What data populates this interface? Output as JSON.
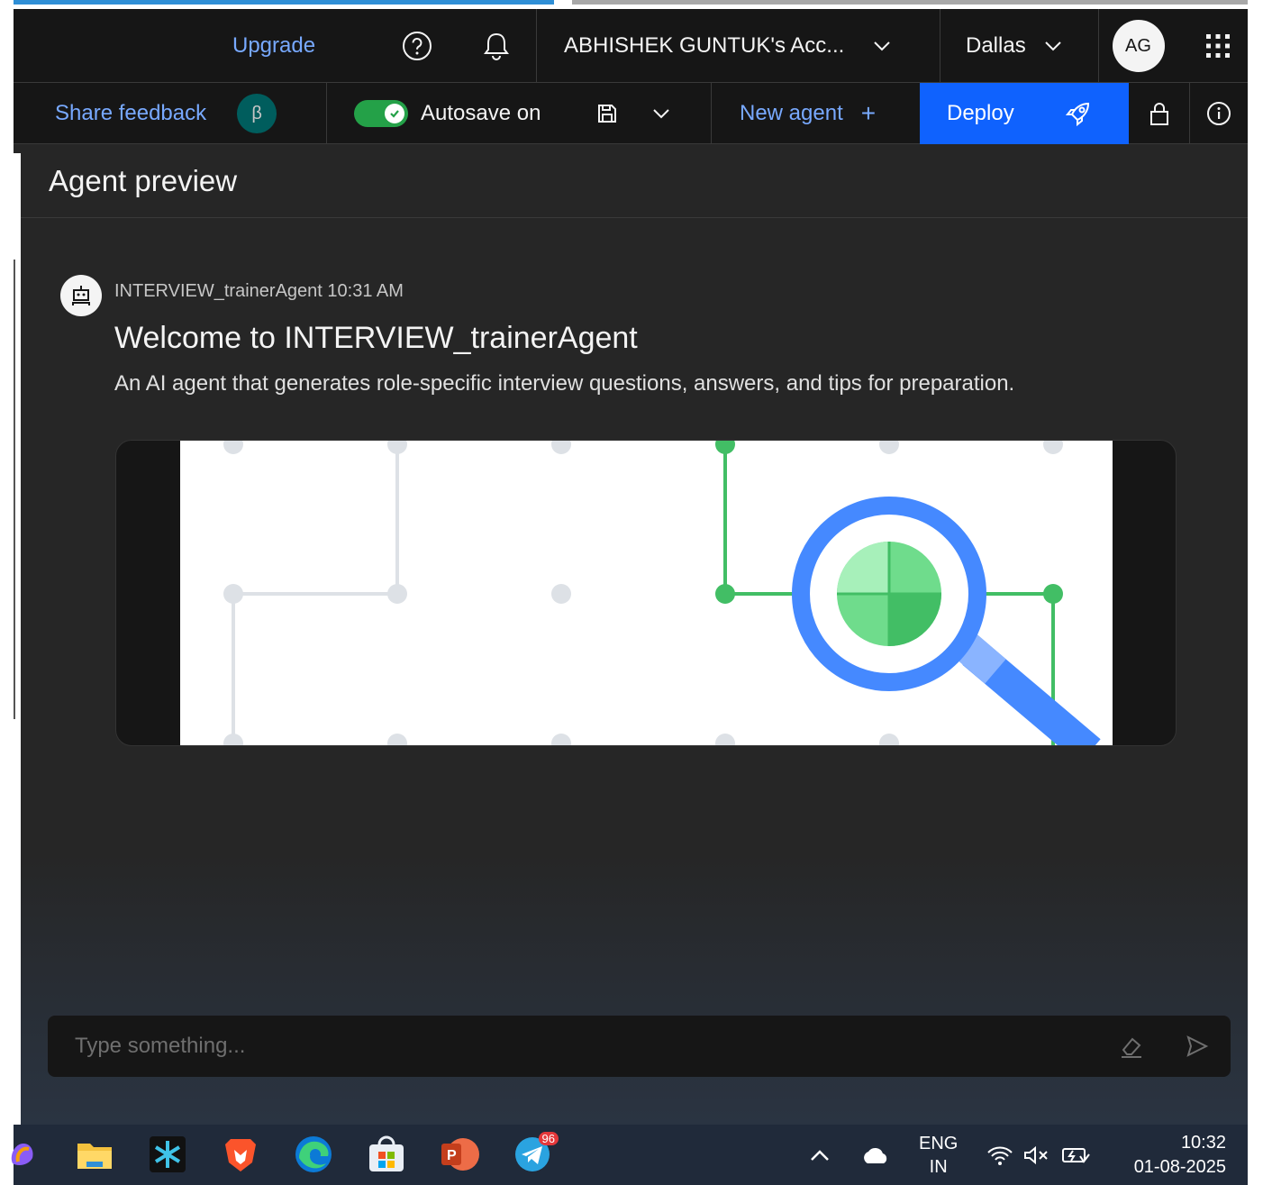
{
  "header": {
    "upgrade_label": "Upgrade",
    "account_label": "ABHISHEK GUNTUK's Acc...",
    "region_label": "Dallas",
    "avatar_initials": "AG"
  },
  "toolbar": {
    "share_feedback_label": "Share feedback",
    "beta_badge": "β",
    "autosave_label": "Autosave on",
    "new_agent_label": "New agent",
    "new_agent_plus": "+",
    "deploy_label": "Deploy"
  },
  "preview": {
    "title": "Agent preview"
  },
  "message": {
    "sender_time": "INTERVIEW_trainerAgent 10:31 AM",
    "title": "Welcome to INTERVIEW_trainerAgent",
    "description": "An AI agent that generates role-specific interview questions, answers, and tips for preparation."
  },
  "chat_input": {
    "placeholder": "Type something..."
  },
  "taskbar": {
    "telegram_badge": "96",
    "lang_line1": "ENG",
    "lang_line2": "IN",
    "time": "10:32",
    "date": "01-08-2025"
  },
  "colors": {
    "accent_blue": "#0f62fe",
    "link_blue": "#78a9ff",
    "toggle_green": "#24a148",
    "background": "#262626"
  }
}
